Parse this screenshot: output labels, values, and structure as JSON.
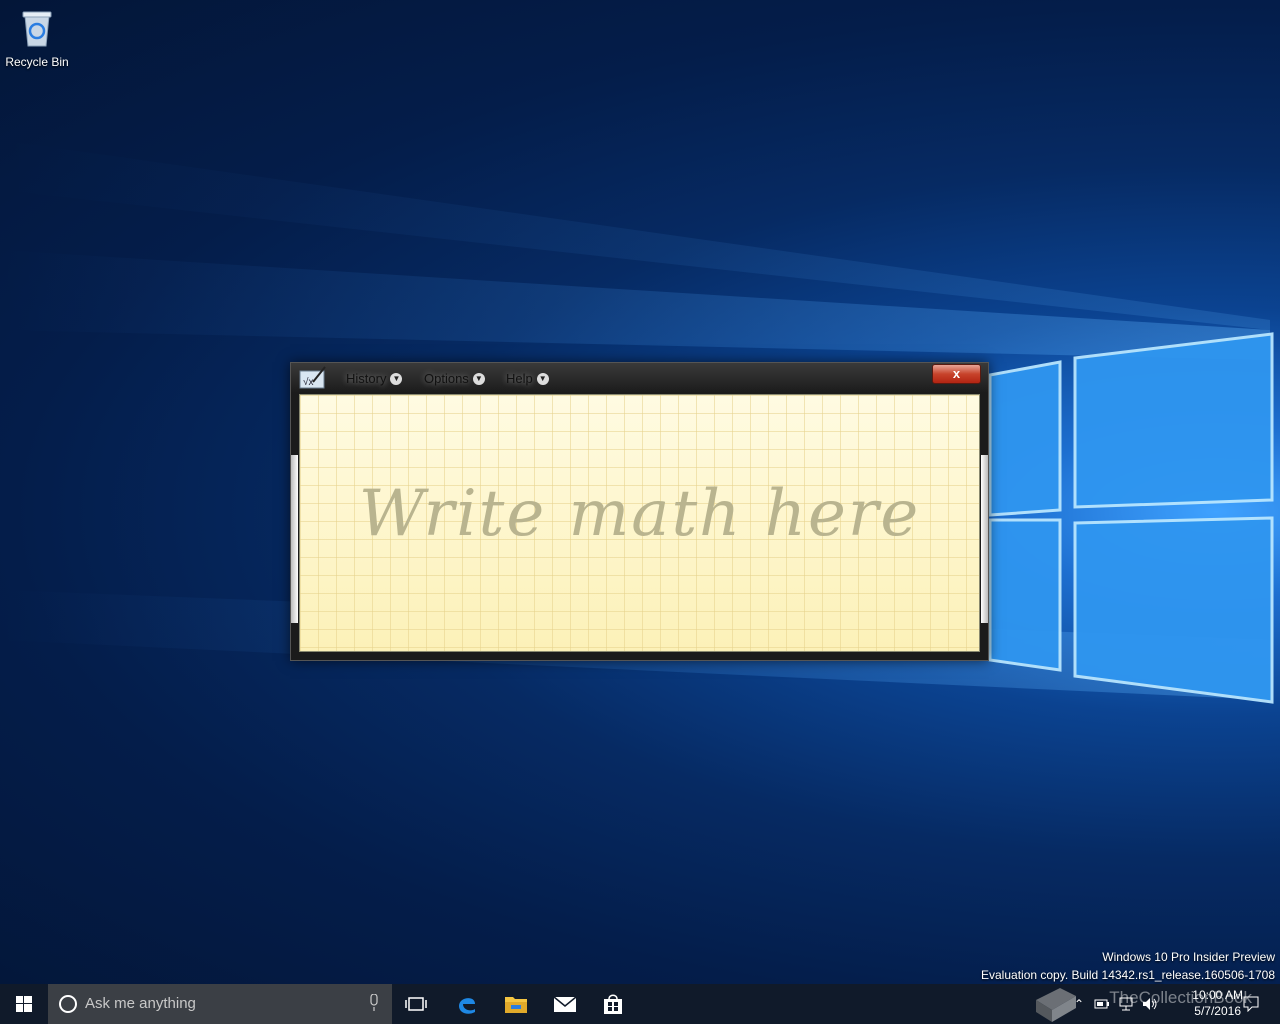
{
  "desktop": {
    "icons": [
      {
        "label": "Recycle Bin",
        "icon": "recycle-bin-icon"
      }
    ]
  },
  "window": {
    "app_icon": "math-input-panel-icon",
    "menus": [
      {
        "label": "History"
      },
      {
        "label": "Options"
      },
      {
        "label": "Help"
      }
    ],
    "close_label": "x",
    "writing_pad": {
      "placeholder": "Write math here"
    }
  },
  "watermark": {
    "line1": "Windows 10 Pro Insider Preview",
    "line2": "Evaluation copy. Build 14342.rs1_release.160506-1708"
  },
  "taskbar": {
    "search_placeholder": "Ask me anything",
    "pinned": [
      "task-view-icon",
      "edge-icon",
      "file-explorer-icon",
      "mail-icon",
      "store-icon"
    ],
    "tray_icons": [
      "chevron-up-icon",
      "battery-icon",
      "network-icon",
      "volume-icon",
      "action-center-icon"
    ],
    "time": "10:00 AM",
    "date": "5/7/2016",
    "overlay_brand": "TheCollectionBook"
  },
  "colors": {
    "taskbar": "#101a2a",
    "pad": "#fdf5c5",
    "close": "#c7432b"
  }
}
